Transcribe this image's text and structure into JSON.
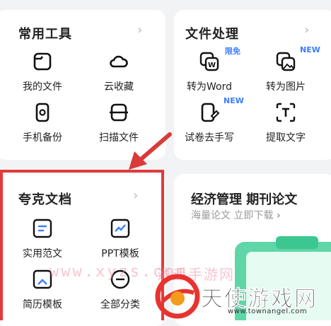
{
  "tools": {
    "title": "常用工具",
    "items": [
      {
        "label": "我的文件",
        "icon": "folder-icon"
      },
      {
        "label": "云收藏",
        "icon": "cloud-icon"
      },
      {
        "label": "手机备份",
        "icon": "phone-backup-icon"
      },
      {
        "label": "扫描文件",
        "icon": "scan-icon"
      }
    ]
  },
  "files": {
    "title": "文件处理",
    "items": [
      {
        "label": "转为Word",
        "icon": "word-convert-icon",
        "badge": "限免"
      },
      {
        "label": "转为图片",
        "icon": "image-convert-icon",
        "badge": "NEW"
      },
      {
        "label": "试卷去手写",
        "icon": "erase-handwriting-icon",
        "badge": "NEW"
      },
      {
        "label": "提取文字",
        "icon": "extract-text-icon"
      }
    ]
  },
  "quark": {
    "title": "夸克文档",
    "items": [
      {
        "label": "实用范文",
        "icon": "essay-icon"
      },
      {
        "label": "PPT模板",
        "icon": "ppt-icon"
      },
      {
        "label": "简历模板",
        "icon": "resume-icon"
      },
      {
        "label": "全部分类",
        "icon": "category-icon"
      }
    ]
  },
  "paper": {
    "title": "经济管理 期刊论文",
    "subtitle": "海量论文 立即下载",
    "chevron": "›"
  },
  "watermark": {
    "url": "www.xyzs.com",
    "cn": "逍遥手游网",
    "logo_text": "天使游戏网",
    "logo_url": "www.townangel.com"
  },
  "colors": {
    "accent": "#3d7dff",
    "highlight": "#e23b3b",
    "arrow": "#d93a3a"
  }
}
